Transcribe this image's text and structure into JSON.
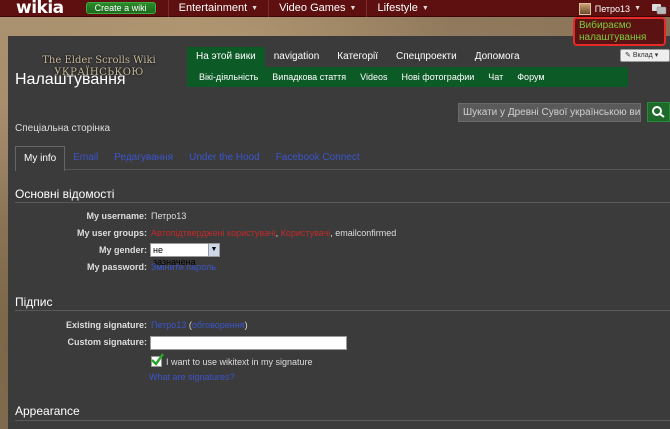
{
  "global": {
    "logo": "wikia",
    "create_wiki": "Create a wiki",
    "nav": [
      {
        "label": "Entertainment"
      },
      {
        "label": "Video Games"
      },
      {
        "label": "Lifestyle"
      }
    ],
    "username": "Петро13",
    "user_menu": {
      "items": [
        "Вибираємо",
        "налаштування"
      ]
    }
  },
  "wiki": {
    "wordmark_line1": "The Elder Scrolls Wiki",
    "wordmark_line2": "УКРАЇНСЬКОЮ",
    "tabs": [
      "На этой вики",
      "navigation",
      "Категорії",
      "Спецпроекти",
      "Допомога"
    ],
    "sub_tabs": [
      "Вікі-діяльність",
      "Випадкова стаття",
      "Videos",
      "Нові фотографии",
      "Чат",
      "Форум"
    ],
    "contribute": "Вклад"
  },
  "page": {
    "title": "Налаштування",
    "subtitle": "Спеціальна сторінка",
    "search_placeholder": "Шукати у Древні Сувої українською ви"
  },
  "prefs_tabs": [
    "My info",
    "Email",
    "Редагування",
    "Under the Hood",
    "Facebook Connect"
  ],
  "basic": {
    "heading": "Основні відомості",
    "username_label": "My username:",
    "username_value": "Петро13",
    "groups_label": "My user groups:",
    "groups_1": "Автопідтверджені користувачі",
    "groups_sep1": ", ",
    "groups_2": "Користувачі",
    "groups_sep2": ", emailconfirmed",
    "gender_label": "My gender:",
    "gender_value": "не зазначена",
    "password_label": "My password:",
    "password_link": "Змінити пароль"
  },
  "signature": {
    "heading": "Підпис",
    "existing_label": "Existing signature:",
    "existing_name": "Петро13",
    "existing_open": " (",
    "existing_talk": "обговорення",
    "existing_close": ")",
    "custom_label": "Custom signature:",
    "custom_value": "",
    "wikitext_label": "I want to use wikitext in my signature",
    "wikitext_checked": true,
    "help_link": "What are signatures?"
  },
  "appearance": {
    "heading": "Appearance"
  },
  "colors": {
    "global_bar": "#5e0f0f",
    "wikinav_green": "#0c5a26",
    "link_red": "#c22a2a",
    "link_blue": "#3b55cc",
    "popup_border": "#e62a2a",
    "popup_text": "#7acc3a"
  }
}
